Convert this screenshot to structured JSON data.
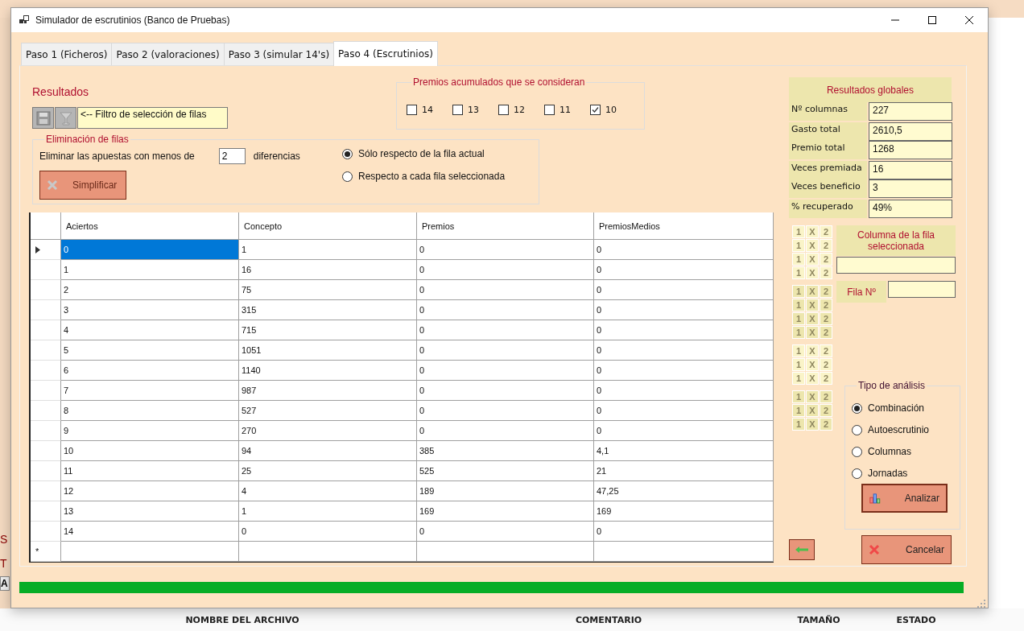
{
  "background": {
    "side_labels": [
      "S",
      "T"
    ],
    "side_button": "A",
    "table_columns": [
      "NOMBRE DEL ARCHIVO",
      "COMENTARIO",
      "TAMAÑO",
      "ESTADO"
    ]
  },
  "window": {
    "title": "Simulador de escrutinios (Banco de Pruebas)"
  },
  "tabs": [
    {
      "label": "Paso 1 (Ficheros)",
      "selected": false
    },
    {
      "label": "Paso 2 (valoraciones)",
      "selected": false
    },
    {
      "label": "Paso 3 (simular 14's)",
      "selected": false
    },
    {
      "label": "Paso 4 (Escrutinios)",
      "selected": true
    }
  ],
  "results": {
    "title": "Resultados",
    "filter_label": "<-- Filtro de selección de filas"
  },
  "prizes_group": {
    "title": "Premios acumulados que se consideran",
    "options": [
      {
        "label": "14",
        "checked": false
      },
      {
        "label": "13",
        "checked": false
      },
      {
        "label": "12",
        "checked": false
      },
      {
        "label": "11",
        "checked": false
      },
      {
        "label": "10",
        "checked": true
      }
    ]
  },
  "elimination": {
    "title": "Eliminación de filas",
    "prefix": "Eliminar las apuestas con menos de",
    "value": "2",
    "suffix": "diferencias",
    "button": "Simplificar",
    "options": [
      {
        "label": "Sólo respecto de la fila actual",
        "selected": true
      },
      {
        "label": "Respecto a cada fila seleccionada",
        "selected": false
      }
    ]
  },
  "table": {
    "columns": [
      "Aciertos",
      "Concepto",
      "Premios",
      "PremiosMedios"
    ],
    "new_row_mark": "*",
    "rows": [
      {
        "cells": [
          "0",
          "1",
          "0",
          "0"
        ],
        "selected": true
      },
      {
        "cells": [
          "1",
          "16",
          "0",
          "0"
        ],
        "selected": false
      },
      {
        "cells": [
          "2",
          "75",
          "0",
          "0"
        ],
        "selected": false
      },
      {
        "cells": [
          "3",
          "315",
          "0",
          "0"
        ],
        "selected": false
      },
      {
        "cells": [
          "4",
          "715",
          "0",
          "0"
        ],
        "selected": false
      },
      {
        "cells": [
          "5",
          "1051",
          "0",
          "0"
        ],
        "selected": false
      },
      {
        "cells": [
          "6",
          "1140",
          "0",
          "0"
        ],
        "selected": false
      },
      {
        "cells": [
          "7",
          "987",
          "0",
          "0"
        ],
        "selected": false
      },
      {
        "cells": [
          "8",
          "527",
          "0",
          "0"
        ],
        "selected": false
      },
      {
        "cells": [
          "9",
          "270",
          "0",
          "0"
        ],
        "selected": false
      },
      {
        "cells": [
          "10",
          "94",
          "385",
          "4,1"
        ],
        "selected": false
      },
      {
        "cells": [
          "11",
          "25",
          "525",
          "21"
        ],
        "selected": false
      },
      {
        "cells": [
          "12",
          "4",
          "189",
          "47,25"
        ],
        "selected": false
      },
      {
        "cells": [
          "13",
          "1",
          "169",
          "169"
        ],
        "selected": false
      },
      {
        "cells": [
          "14",
          "0",
          "0",
          "0"
        ],
        "selected": false
      }
    ]
  },
  "global_results": {
    "title": "Resultados globales",
    "groups": [
      [
        {
          "label": "Nº columnas",
          "value": "227"
        }
      ],
      [
        {
          "label": "Gasto total",
          "value": "2610,5"
        },
        {
          "label": "Premio total",
          "value": "1268"
        }
      ],
      [
        {
          "label": "Veces premiada",
          "value": "16"
        },
        {
          "label": "Veces beneficio",
          "value": "3"
        }
      ],
      [
        {
          "label": "% recuperado",
          "value": "49%"
        }
      ]
    ]
  },
  "quiniela_grid": {
    "groups": [
      [
        [
          "1",
          "X",
          "2"
        ],
        [
          "1",
          "X",
          "2"
        ],
        [
          "1",
          "X",
          "2"
        ],
        [
          "1",
          "X",
          "2"
        ]
      ],
      [
        [
          "1",
          "X",
          "2"
        ],
        [
          "1",
          "X",
          "2"
        ],
        [
          "1",
          "X",
          "2"
        ],
        [
          "1",
          "X",
          "2"
        ]
      ],
      [
        [
          "1",
          "X",
          "2"
        ],
        [
          "1",
          "X",
          "2"
        ],
        [
          "1",
          "X",
          "2"
        ]
      ],
      [
        [
          "1",
          "X",
          "2"
        ],
        [
          "1",
          "X",
          "2"
        ],
        [
          "1",
          "X",
          "2"
        ]
      ]
    ]
  },
  "selected_column": {
    "title": "Columna de la fila seleccionada",
    "row_label": "Fila Nº"
  },
  "analysis": {
    "title": "Tipo de análisis",
    "button": "Analizar",
    "options": [
      {
        "label": "Combinación",
        "selected": true
      },
      {
        "label": "Autoescrutinio",
        "selected": false
      },
      {
        "label": "Columnas",
        "selected": false
      },
      {
        "label": "Jornadas",
        "selected": false
      }
    ]
  },
  "cancel_button": "Cancelar",
  "progress": {
    "level": 1
  }
}
